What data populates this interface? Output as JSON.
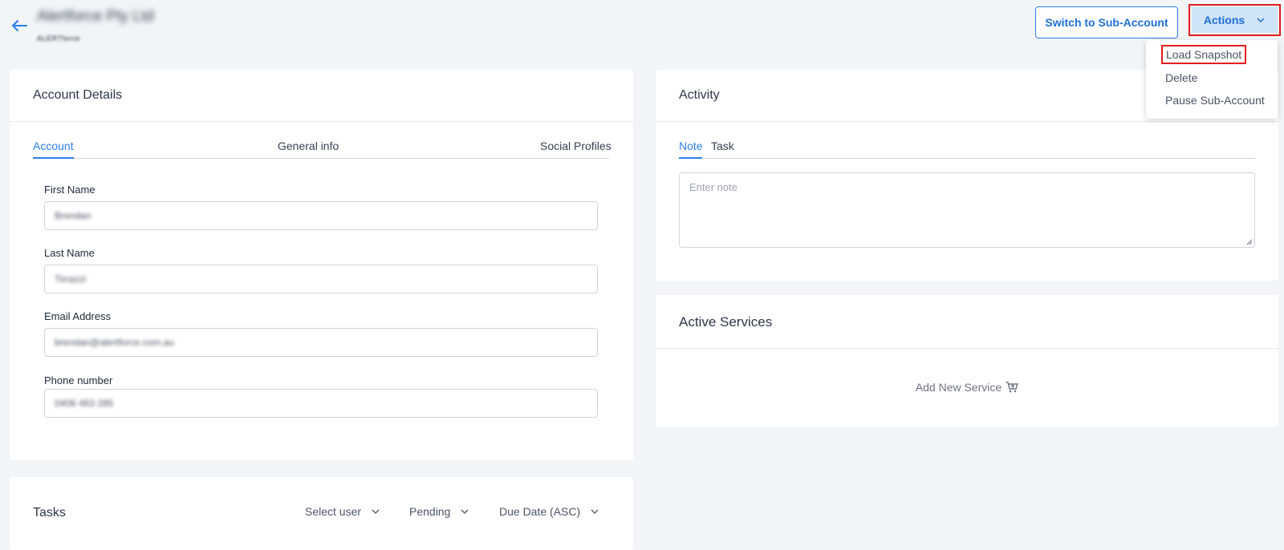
{
  "header": {
    "company_name": "Alertforce Pty Ltd",
    "company_logo_text": "ALERTforce",
    "switch_button": "Switch to Sub-Account",
    "actions_button": "Actions"
  },
  "actions_menu": {
    "items": [
      "Load Snapshot",
      "Delete",
      "Pause Sub-Account"
    ]
  },
  "account_details": {
    "title": "Account Details",
    "tabs": [
      "Account",
      "General info",
      "Social Profiles"
    ],
    "active_tab": "Account",
    "fields": [
      {
        "label": "First Name",
        "value": "Brendan"
      },
      {
        "label": "Last Name",
        "value": "Tirrazzi"
      },
      {
        "label": "Email Address",
        "value": "brendan@alertforce.com.au"
      },
      {
        "label": "Phone number",
        "value": "0406 463 285"
      }
    ]
  },
  "activity": {
    "title": "Activity",
    "tabs": [
      "Note",
      "Task"
    ],
    "active_tab": "Note",
    "note_placeholder": "Enter note"
  },
  "active_services": {
    "title": "Active Services",
    "add_label": "Add New Service"
  },
  "tasks": {
    "title": "Tasks",
    "filters": [
      "Select user",
      "Pending",
      "Due Date (ASC)"
    ]
  },
  "colors": {
    "accent": "#2b7de9",
    "highlight_box": "#e11d1d",
    "background": "#f1f5f8"
  }
}
